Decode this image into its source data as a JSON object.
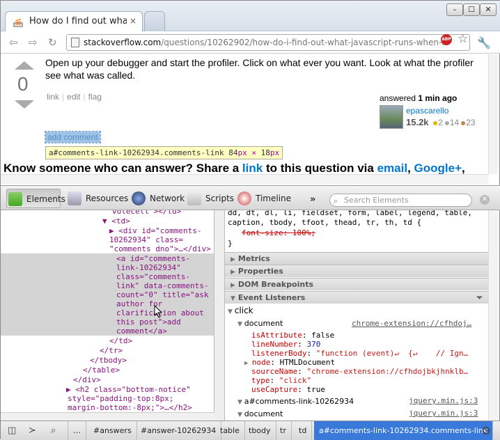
{
  "browser": {
    "tab_title": "How do I find out what",
    "tab_close": "×",
    "new_tab_label": "",
    "window_buttons": [
      "–",
      "☐",
      "✕"
    ],
    "url_host": "stackoverflow.com",
    "url_path": "/questions/10262902/how-do-i-find-out-what-javascript-runs-when-i-click-a",
    "abp_label": "ABP"
  },
  "page": {
    "vote_count": "0",
    "answer_text": "Open up your debugger and start the profiler. Click on what ever you want. Look at what the profiler see what was called.",
    "post_menu": [
      "link",
      "edit",
      "flag"
    ],
    "answered_label": "answered",
    "answered_time": "1 min ago",
    "user_name": "epascarello",
    "user_rep": "15.2k",
    "badges": {
      "gold": "2",
      "silver": "14",
      "bronze": "23"
    },
    "add_comment": "add comment",
    "tooltip_selector": "a#comments-link-10262934.comments-link",
    "tooltip_w": "84",
    "tooltip_x": "px × ",
    "tooltip_h": "18",
    "tooltip_unit": "px",
    "banner_pre": "Know someone who can answer? Share a ",
    "banner_link": "link",
    "banner_mid": " to this question via ",
    "banner_email": "email",
    "banner_sep": ", ",
    "banner_gplus": "Google+",
    "banner_end": ","
  },
  "devtools": {
    "tabs": [
      "Elements",
      "Resources",
      "Network",
      "Scripts",
      "Timeline"
    ],
    "more": "»",
    "search_placeholder": "Search Elements",
    "dom_lines": [
      "votecell\"></td>",
      "▼ <td>",
      "▶ <div id=\"comments-",
      "10262934\" class=",
      "\"comments dno\">…</div>",
      "<a id=\"comments-",
      "link-10262934\"",
      "class=\"comments-",
      "link\" data-comments-",
      "count=\"0\" title=\"ask",
      "author for",
      "clarification about",
      "this post\">add",
      "comment</a>",
      "</td>",
      "</tr>",
      "</tbody>",
      "</table>",
      "</div>",
      "▶ <h2 class=\"bottom-notice\"",
      "style=\"padding-top:8px;",
      "margin-bottom:-8px;\">…</h2>"
    ],
    "styles_lines": [
      "dd, dt, dl, li, fieldset, form, label, legend, table,",
      "caption, tbody, tfoot, thead, tr, th, td {",
      "font-size: 100%;",
      "}"
    ],
    "sections": [
      "Metrics",
      "Properties",
      "DOM Breakpoints",
      "Event Listeners"
    ],
    "event": "click",
    "listener1_node": "document",
    "listener1_src": "chrome-extension://cfhdoj…",
    "props": [
      {
        "k": "isAttribute",
        "v": "false"
      },
      {
        "k": "lineNumber",
        "v": "370"
      },
      {
        "k": "listenerBody",
        "v": "\"function (event)↵  {↵    // Ign…"
      },
      {
        "k": "node",
        "v": "HTMLDocument"
      },
      {
        "k": "sourceName",
        "v": "\"chrome-extension://cfhdojbkjhnklb…"
      },
      {
        "k": "type",
        "v": "\"click\""
      },
      {
        "k": "useCapture",
        "v": "true"
      }
    ],
    "listener2_node": "a#comments-link-10262934",
    "listener2_src": "jquery.min.js:3",
    "listener3_node": "document",
    "listener3_src": "jquery.min.js:3",
    "breadcrumbs": [
      "…",
      "#answers",
      "#answer-10262934",
      "table",
      "tbody",
      "tr",
      "td",
      "a#comments-link-10262934.comments-link"
    ]
  }
}
